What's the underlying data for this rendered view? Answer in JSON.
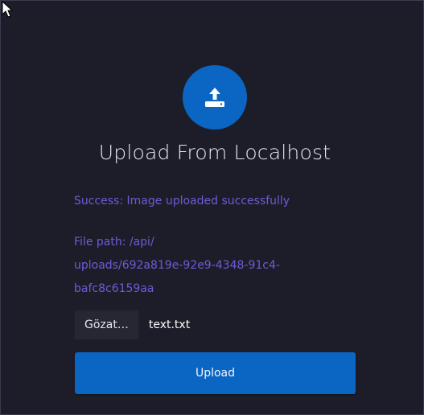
{
  "header": {
    "title": "Upload From Localhost",
    "icon": "upload-icon",
    "accent_color": "#0a66c2"
  },
  "status": {
    "message": "Success: Image uploaded successfully",
    "file_path_line1": "File path: /api/",
    "file_path_line2": "uploads/692a819e-92e9-4348-91c4-",
    "file_path_line3": "bafc8c6159aa",
    "color": "#6c5cd6"
  },
  "file_input": {
    "browse_label": "Gözat…",
    "selected_file": "text.txt"
  },
  "actions": {
    "upload_label": "Upload"
  }
}
